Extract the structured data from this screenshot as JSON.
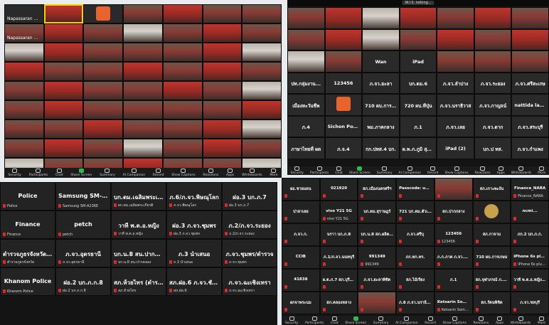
{
  "q1": {
    "tiles": [
      {
        "name": "Napassaran Nu...",
        "kind": "blank"
      },
      {
        "name": "",
        "kind": "video red",
        "active": true
      },
      {
        "name": "",
        "kind": "avatar"
      },
      {
        "name": "",
        "kind": "video"
      },
      {
        "name": "",
        "kind": "video red"
      },
      {
        "name": "",
        "kind": "video"
      },
      {
        "name": "",
        "kind": "video"
      },
      {
        "name": "Napassaran Nuchsaku",
        "kind": "video"
      },
      {
        "name": "",
        "kind": "video red"
      },
      {
        "name": "",
        "kind": "video"
      },
      {
        "name": "",
        "kind": "video alt"
      },
      {
        "name": "",
        "kind": "video"
      },
      {
        "name": "",
        "kind": "video red"
      },
      {
        "name": "",
        "kind": "video"
      },
      {
        "name": "",
        "kind": "video alt"
      },
      {
        "name": "",
        "kind": "video red"
      },
      {
        "name": "",
        "kind": "video"
      },
      {
        "name": "",
        "kind": "video"
      },
      {
        "name": "",
        "kind": "video"
      },
      {
        "name": "",
        "kind": "video red"
      },
      {
        "name": "",
        "kind": "video alt"
      },
      {
        "name": "",
        "kind": "video red"
      },
      {
        "name": "",
        "kind": "video"
      },
      {
        "name": "",
        "kind": "video"
      },
      {
        "name": "",
        "kind": "video red"
      },
      {
        "name": "",
        "kind": "video"
      },
      {
        "name": "",
        "kind": "video red"
      },
      {
        "name": "",
        "kind": "video"
      },
      {
        "name": "",
        "kind": "video"
      },
      {
        "name": "",
        "kind": "video red"
      },
      {
        "name": "",
        "kind": "video"
      },
      {
        "name": "",
        "kind": "video"
      },
      {
        "name": "",
        "kind": "video red"
      },
      {
        "name": "",
        "kind": "video"
      },
      {
        "name": "",
        "kind": "video alt"
      },
      {
        "name": "",
        "kind": "video"
      },
      {
        "name": "",
        "kind": "video red"
      },
      {
        "name": "",
        "kind": "video"
      },
      {
        "name": "",
        "kind": "video"
      },
      {
        "name": "",
        "kind": "video"
      },
      {
        "name": "",
        "kind": "video"
      },
      {
        "name": "",
        "kind": "video red"
      },
      {
        "name": "",
        "kind": "video"
      },
      {
        "name": "",
        "kind": "video"
      },
      {
        "name": "",
        "kind": "video red"
      },
      {
        "name": "",
        "kind": "video"
      },
      {
        "name": "",
        "kind": "video"
      },
      {
        "name": "",
        "kind": "video red"
      },
      {
        "name": "",
        "kind": "video alt"
      },
      {
        "name": "",
        "kind": "video"
      },
      {
        "name": "",
        "kind": "video red"
      },
      {
        "name": "",
        "kind": "video"
      },
      {
        "name": "",
        "kind": "video alt"
      },
      {
        "name": "",
        "kind": "video"
      },
      {
        "name": "",
        "kind": "video red"
      },
      {
        "name": "",
        "kind": "video"
      },
      {
        "name": "",
        "kind": "video alt"
      },
      {
        "name": "",
        "kind": "video"
      },
      {
        "name": "",
        "kind": "video"
      },
      {
        "name": "",
        "kind": "video red"
      },
      {
        "name": "",
        "kind": "video"
      },
      {
        "name": "",
        "kind": "video"
      },
      {
        "name": "",
        "kind": "video alt"
      },
      {
        "name": "",
        "kind": "video red"
      }
    ],
    "toolbar": [
      "Security",
      "Participants",
      "Chat",
      "Share Screen",
      "Summary",
      "AI Companion",
      "Record",
      "Show Captions",
      "Reactions",
      "Apps",
      "Whiteboards",
      "More"
    ]
  },
  "q2": {
    "speaking": "W.I.S. talking...",
    "tiles": [
      {
        "name": "",
        "kind": "video"
      },
      {
        "name": "",
        "kind": "video red"
      },
      {
        "name": "",
        "kind": "video alt"
      },
      {
        "name": "",
        "kind": "video red"
      },
      {
        "name": "",
        "kind": "video"
      },
      {
        "name": "",
        "kind": "video red"
      },
      {
        "name": "",
        "kind": "video"
      },
      {
        "name": "",
        "kind": "video"
      },
      {
        "name": "",
        "kind": "video red"
      },
      {
        "name": "",
        "kind": "video alt"
      },
      {
        "name": "",
        "kind": "video"
      },
      {
        "name": "",
        "kind": "video red"
      },
      {
        "name": "",
        "kind": "video"
      },
      {
        "name": "",
        "kind": "video red"
      },
      {
        "name": "",
        "kind": "video alt"
      },
      {
        "name": "",
        "kind": "video"
      },
      {
        "name": "Wan",
        "kind": "text"
      },
      {
        "name": "iPad",
        "kind": "text"
      },
      {
        "name": "",
        "kind": "video"
      },
      {
        "name": "",
        "kind": "video"
      },
      {
        "name": "",
        "kind": "video"
      },
      {
        "name": "ปท.กลุ่มงาน...",
        "kind": "text"
      },
      {
        "name": "123456",
        "kind": "text"
      },
      {
        "name": "ภ.จว.ยะลา",
        "kind": "text"
      },
      {
        "name": "บก.ตม.6",
        "kind": "text"
      },
      {
        "name": "ภ.จว.ลำปาง",
        "kind": "text"
      },
      {
        "name": "ภ.จว.ระยอง",
        "kind": "text"
      },
      {
        "name": "ภ.จว.ศรีสะเกษ",
        "kind": "text"
      },
      {
        "name": "เมืองหะวันชีพ",
        "kind": "text"
      },
      {
        "name": "",
        "kind": "avatar"
      },
      {
        "name": "710 ผบ.การอน",
        "kind": "text"
      },
      {
        "name": "720 ผบ.ทีปุ่น",
        "kind": "text"
      },
      {
        "name": "ภ.จว.นราธิวาส",
        "kind": "text"
      },
      {
        "name": "ภ.จว.กาญจน์",
        "kind": "text"
      },
      {
        "name": "nattida lamnoi",
        "kind": "text"
      },
      {
        "name": "ภ.4",
        "kind": "text"
      },
      {
        "name": "Sichon Police1",
        "kind": "text"
      },
      {
        "name": "พม.ภาคกลาง",
        "kind": "text"
      },
      {
        "name": "ภ.1",
        "kind": "text"
      },
      {
        "name": "ภ.จว.เลย",
        "kind": "text"
      },
      {
        "name": "ภ.จว.ตาก",
        "kind": "text"
      },
      {
        "name": "ภ.จว.สระบุรี",
        "kind": "text"
      },
      {
        "name": "ภาษาไทยที่ ผด",
        "kind": "text"
      },
      {
        "name": "ภ.จ.4",
        "kind": "text"
      },
      {
        "name": "กก.ปทส.4 บก.",
        "kind": "text"
      },
      {
        "name": "ผ.พ.ภ.ภูมิ สุจริต",
        "kind": "text"
      },
      {
        "name": "iPad (2)",
        "kind": "text"
      },
      {
        "name": "บก.ป ทส.",
        "kind": "text"
      },
      {
        "name": "ภ.จว.กำแพง",
        "kind": "text"
      }
    ],
    "toolbar": [
      "Security",
      "Participants",
      "Chat",
      "Share Screen",
      "Summary",
      "AI Companion",
      "Record",
      "Show Captions",
      "Reactions",
      "Apps",
      "Whiteboards",
      "More"
    ]
  },
  "q3": {
    "tiles": [
      {
        "title": "Police",
        "sub": "Police"
      },
      {
        "title": "Samsung SM-A...",
        "sub": "Samsung SM-A236E"
      },
      {
        "title": "บก.ตม.เฉลิมพระเกียรติ",
        "sub": "ผก.ตม.เฉลิมพระเกียรติ"
      },
      {
        "title": "ภ.6/ภ.จว.พิษณุโลก",
        "sub": "ภ.จว.พิษณุโลก"
      },
      {
        "title": "ฝอ.3 บก.ภ.7",
        "sub": "ฝอ.3 บก.ภ.7"
      },
      {
        "title": "Finance",
        "sub": "Finance"
      },
      {
        "title": "petch",
        "sub": "petch"
      },
      {
        "title": "วาที พ.ต.อ.หญิง",
        "sub": "วาที พ.ต.อ.หญิง"
      },
      {
        "title": "ฝอ.3 ภ.จว.ชุมพร",
        "sub": "ฝอ.3 ภ.จว.ชุมพร"
      },
      {
        "title": "ภ.2/ภ.จว.ระยอง",
        "sub": "ภ.2/ภ.จว.ระยอง"
      },
      {
        "title": "ตำรวจภูธรจังหวัด...",
        "sub": "ตำรวจภูธรจังหวัด"
      },
      {
        "title": "ภ.จว.อุดรธานี",
        "sub": "ภ.จว.อุดรธานี"
      },
      {
        "title": "บก.น.8 สน.ปากคลอง",
        "sub": "บก.น.8 สน.ปากคลอง"
      },
      {
        "title": "ภ.3 นำเสนอ",
        "sub": "ภ.3 นำเสนอ"
      },
      {
        "title": "ภ.จว.ชุมพร/ตำรวจ",
        "sub": "ภ.จว.ชุมพร"
      },
      {
        "title": "Khanom Police",
        "sub": "Khanom Police"
      },
      {
        "title": "ฝอ.2 บก.ภ.ก.8",
        "sub": "ฝอ.2 บก.ภ.ก.8"
      },
      {
        "title": "สภ.ห้วยไทร (ตำรวจ)",
        "sub": "สภ.ห้วยไทร"
      },
      {
        "title": "สภ.ฝอ.6 ภ.จว.ชัย...",
        "sub": "สภ.ฝอ.6"
      },
      {
        "title": "ภ.จว.ฉะเชิงเทรา",
        "sub": "ภ.จว.ฉะเชิงเทรา"
      }
    ]
  },
  "q4": {
    "tiles": [
      {
        "title": "ผอ.ชายแดน",
        "sub": ""
      },
      {
        "title": "021920",
        "sub": ""
      },
      {
        "title": "สภ.เมืองนครศรีฯ",
        "sub": ""
      },
      {
        "title": "Passcode: ukpol...",
        "sub": ""
      },
      {
        "title": "",
        "sub": "",
        "kind": "video"
      },
      {
        "title": "สภ.เกาะพะงัน",
        "sub": ""
      },
      {
        "title": "Finance_NARA",
        "sub": "Finance_NARA"
      },
      {
        "title": "ปาลาเลย",
        "sub": ""
      },
      {
        "title": "vivo Y21 5G",
        "sub": "vivo Y21 5G"
      },
      {
        "title": "บก.ตม.สุราษฎร์",
        "sub": ""
      },
      {
        "title": "721 บก.ตม.ตัวเมือง",
        "sub": ""
      },
      {
        "title": "สภ.ปากกลาง",
        "sub": ""
      },
      {
        "title": "",
        "sub": "",
        "kind": "logo"
      },
      {
        "title": "ncmi...",
        "sub": ""
      },
      {
        "title": "ภ.จว.ก.",
        "sub": ""
      },
      {
        "title": "นราา บก.ภ.8",
        "sub": ""
      },
      {
        "title": "บก.น.8 สภ.ผลิตคดี",
        "sub": ""
      },
      {
        "title": "ภ.จว.ศรีบุ",
        "sub": ""
      },
      {
        "title": "123456",
        "sub": "123456"
      },
      {
        "title": "สภ.กาจาม",
        "sub": ""
      },
      {
        "title": "ภก.2 บก.ภ.ก.",
        "sub": ""
      },
      {
        "title": "CCIB",
        "sub": ""
      },
      {
        "title": "ภ.1/ภ.จว.นนทบุรี",
        "sub": ""
      },
      {
        "title": "991349",
        "sub": "991349"
      },
      {
        "title": "ภก.ทก.ทร.",
        "sub": ""
      },
      {
        "title": "ภ.ก.ภาค ภ.จว.กพร.",
        "sub": ""
      },
      {
        "title": "710 ผบ.การเกษม",
        "sub": ""
      },
      {
        "title": "iPhone 6s plus (2)",
        "sub": "iPhone 6s plus (2)"
      },
      {
        "title": "41838",
        "sub": ""
      },
      {
        "title": "ผ.ต.ภ.7 สภ.บุรีรามย์",
        "sub": ""
      },
      {
        "title": "ภ.จว.ยะลาพิชิต",
        "sub": ""
      },
      {
        "title": "สภ.ไม้เรียง",
        "sub": ""
      },
      {
        "title": "ภ.1",
        "sub": ""
      },
      {
        "title": "สภ.จุฬาภรณ์ ภ.จว.",
        "sub": ""
      },
      {
        "title": "วาที พ.ต.อ.หญิงบุษกร",
        "sub": ""
      },
      {
        "title": "ผกจาพระนม",
        "sub": ""
      },
      {
        "title": "สภ.คลองหลาง",
        "sub": ""
      },
      {
        "title": "",
        "sub": "",
        "kind": "video"
      },
      {
        "title": "ภ.8 ภ.จว.นราธิวาส",
        "sub": ""
      },
      {
        "title": "Ketsarin Somphan",
        "sub": "Ketsarin Somphan"
      },
      {
        "title": "สภ.รัตนพิชิต",
        "sub": ""
      },
      {
        "title": "ภ.จว.ชลบุรี",
        "sub": ""
      }
    ],
    "toolbar": [
      "Security",
      "Participants",
      "Chat",
      "Share Screen",
      "Summary",
      "AI Companion",
      "Record",
      "Show Captions",
      "Reactions",
      "Apps",
      "Whiteboards",
      "More"
    ]
  },
  "colors": {
    "mic_muted": "#e02828",
    "active_speaker": "#f5d400",
    "share_green": "#2bbd4a",
    "end": "#d93025"
  }
}
